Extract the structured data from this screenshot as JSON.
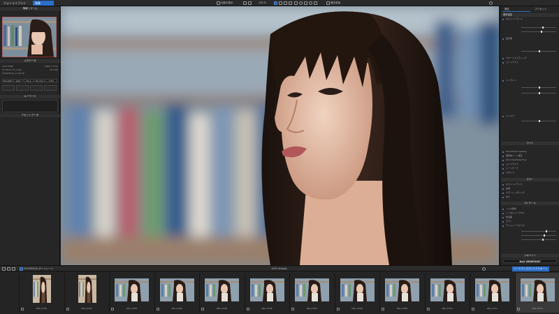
{
  "topbar": {
    "tab_library": "フォトライブラリ",
    "tab_develop": "現像",
    "btn_compare": "比較の表示",
    "zoom": "100 %",
    "btn_before_after": "補正前後"
  },
  "left_panel": {
    "navigator_title": "情報 / ズーム",
    "metadata_title": "メタデータ",
    "meta_rows": [
      {
        "label": "ILCE-7RM4",
        "value": "3686 x 3712"
      },
      {
        "label": "FE 50mm F1.2 GM",
        "value": "42.0 MP"
      },
      {
        "label": "2020/05/10 11:46:42",
        "value": ""
      }
    ],
    "exif": [
      "ISO 400",
      "1/60",
      "f/1.2",
      "50 mm",
      "0 EV"
    ],
    "keywords_title": "キーワード",
    "assets_title": "アセットデータ"
  },
  "right_panel": {
    "tab_active": "補正",
    "tab_other": "プリセット",
    "sections": {
      "basic": "基本設定",
      "light": "ライト",
      "color": "カラー",
      "detail": "ディテール",
      "geometry": "ジオメトリ"
    },
    "items_top": [
      "ホワイトバランス",
      "露光量",
      "スマートライティング",
      "コントラスト",
      "ハイライト",
      "シャドウ"
    ],
    "items_light": [
      "DxO Smart Lighting",
      "選択的トーン補正",
      "DxO ClearView Plus",
      "コントラスト",
      "トーンカーブ",
      "ビネット"
    ],
    "items_color": [
      "ホワイトバランス",
      "彩度",
      "カラーレンダリング",
      "HSL"
    ],
    "items_detail": [
      "ノイズ除去",
      "レンズシャープネス",
      "色収差",
      "モアレ",
      "アンシャープマスク"
    ],
    "bottom_buttons": [
      "DxO VIEWPOINT",
      "DxO FILMPACK"
    ]
  },
  "filmbar": {
    "folder": "2020/05/10 ポートレート",
    "count": "1093 images",
    "export_button": "ハードディスクにエクスポート"
  },
  "filmstrip": [
    {
      "label": "DSC_17701",
      "portrait": true,
      "selected": false
    },
    {
      "label": "DSC_17702",
      "portrait": true,
      "selected": false
    },
    {
      "label": "DSC_17703",
      "portrait": false,
      "selected": false
    },
    {
      "label": "DSC_17704",
      "portrait": false,
      "selected": false
    },
    {
      "label": "DSC_17705",
      "portrait": false,
      "selected": false
    },
    {
      "label": "DSC_17706",
      "portrait": false,
      "selected": false
    },
    {
      "label": "DSC_17707",
      "portrait": false,
      "selected": false
    },
    {
      "label": "DSC_17708",
      "portrait": false,
      "selected": false
    },
    {
      "label": "DSC_17709",
      "portrait": false,
      "selected": false
    },
    {
      "label": "DSC_17710",
      "portrait": false,
      "selected": false
    },
    {
      "label": "DSC_17711",
      "portrait": false,
      "selected": false
    },
    {
      "label": "DSC_17712",
      "portrait": false,
      "selected": true
    }
  ],
  "colors": {
    "accent": "#2a6fc9",
    "panel": "#262626",
    "viewer_bg": "#7b8b98"
  }
}
